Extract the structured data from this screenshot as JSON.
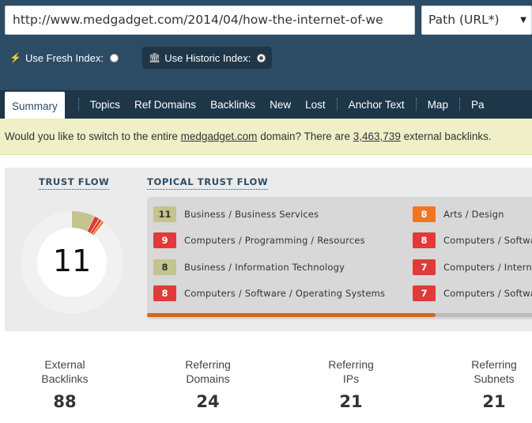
{
  "search": {
    "url_value": "http://www.medgadget.com/2014/04/how-the-internet-of-we",
    "scope_selected": "Path (URL*)"
  },
  "index": {
    "fresh_label": "Use Fresh Index:",
    "historic_label": "Use Historic Index:",
    "fresh_icon": "lightning-icon",
    "historic_icon": "bank-icon",
    "selected": "historic"
  },
  "tabs": [
    {
      "label": "Summary",
      "active": true
    },
    {
      "label": "Topics"
    },
    {
      "label": "Ref Domains"
    },
    {
      "label": "Backlinks"
    },
    {
      "label": "New"
    },
    {
      "label": "Lost"
    },
    {
      "label": "Anchor Text"
    },
    {
      "label": "Map"
    },
    {
      "label": "Pa"
    }
  ],
  "notice": {
    "prefix": "Would you like to switch to the entire ",
    "domain_link": "medgadget.com",
    "middle": " domain? There are ",
    "count_link": "3,463,739",
    "suffix": " external backlinks."
  },
  "trust": {
    "trust_flow_title": "TRUST FLOW",
    "topical_title": "TOPICAL TRUST FLOW",
    "trust_flow_value": "11",
    "topical_progress_fraction": 0.75,
    "topics": [
      {
        "value": "11",
        "label": "Business / Business Services",
        "color": "#c3c48e"
      },
      {
        "value": "9",
        "label": "Computers / Programming / Resources",
        "color": "#e03a3a"
      },
      {
        "value": "8",
        "label": "Business / Information Technology",
        "color": "#c3c48e"
      },
      {
        "value": "8",
        "label": "Computers / Software / Operating Systems",
        "color": "#e03a3a"
      },
      {
        "value": "8",
        "label": "Arts / Design",
        "color": "#ef7622"
      },
      {
        "value": "8",
        "label": "Computers / Softwa",
        "color": "#e03a3a"
      },
      {
        "value": "7",
        "label": "Computers / Interne",
        "color": "#e03a3a"
      },
      {
        "value": "7",
        "label": "Computers / Softwa",
        "color": "#e03a3a"
      }
    ]
  },
  "stats": [
    {
      "label_line1": "External",
      "label_line2": "Backlinks",
      "value": "88"
    },
    {
      "label_line1": "Referring",
      "label_line2": "Domains",
      "value": "24"
    },
    {
      "label_line1": "Referring",
      "label_line2": "IPs",
      "value": "21"
    },
    {
      "label_line1": "Referring",
      "label_line2": "Subnets",
      "value": "21"
    }
  ]
}
